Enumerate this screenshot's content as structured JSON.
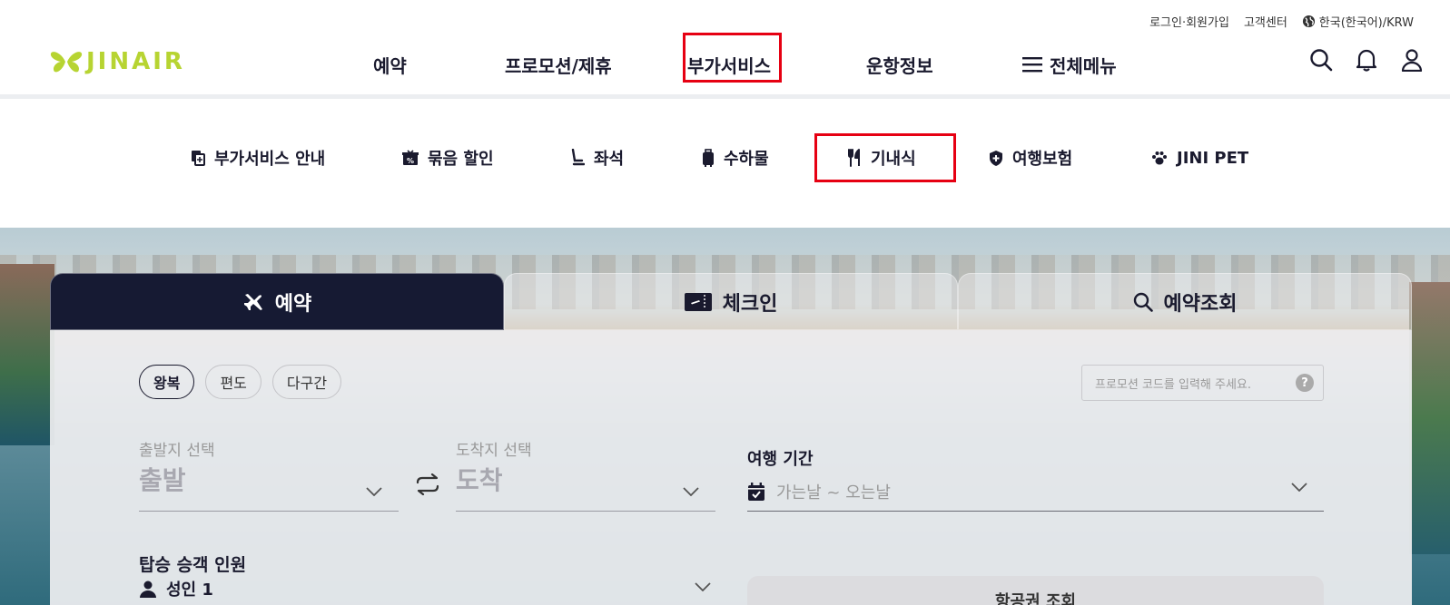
{
  "util_bar": {
    "login": "로그인·회원가입",
    "support": "고객센터",
    "language": "한국(한국어)/KRW"
  },
  "brand": {
    "logo_text": "JINAIR",
    "accent_color": "#b7d432",
    "navy": "#161a33",
    "highlight_red": "#e60012"
  },
  "gnb": [
    {
      "label": "예약"
    },
    {
      "label": "프로모션/제휴"
    },
    {
      "label": "부가서비스",
      "active": true
    },
    {
      "label": "운항정보"
    },
    {
      "label": "전체메뉴",
      "icon": "hamburger-icon"
    }
  ],
  "header_icons": [
    "search-icon",
    "bell-icon",
    "user-icon"
  ],
  "subnav": [
    {
      "label": "부가서비스 안내",
      "icon": "copy-plus-icon"
    },
    {
      "label": "묶음 할인",
      "icon": "discount-box-icon"
    },
    {
      "label": "좌석",
      "icon": "seat-icon"
    },
    {
      "label": "수하물",
      "icon": "luggage-icon"
    },
    {
      "label": "기내식",
      "icon": "fork-knife-icon",
      "highlighted": true
    },
    {
      "label": "여행보험",
      "icon": "shield-plus-icon"
    },
    {
      "label": "JINI PET",
      "icon": "paw-icon"
    }
  ],
  "booking": {
    "tabs": [
      {
        "label": "예약",
        "icon": "airplane-icon",
        "active": true
      },
      {
        "label": "체크인",
        "icon": "ticket-icon"
      },
      {
        "label": "예약조회",
        "icon": "search-icon"
      }
    ],
    "trip_types": [
      {
        "label": "왕복",
        "selected": true
      },
      {
        "label": "편도"
      },
      {
        "label": "다구간"
      }
    ],
    "promo_placeholder": "프로모션 코드를 입력해 주세요.",
    "promo_help": "?",
    "departure": {
      "label": "출발지 선택",
      "value": "출발"
    },
    "arrival": {
      "label": "도착지 선택",
      "value": "도착"
    },
    "period": {
      "label": "여행 기간",
      "placeholder": "가는날 ~ 오는날"
    },
    "passengers": {
      "label": "탑승 승객 인원",
      "value": "성인 1"
    },
    "search_button": "항공권 조회"
  }
}
